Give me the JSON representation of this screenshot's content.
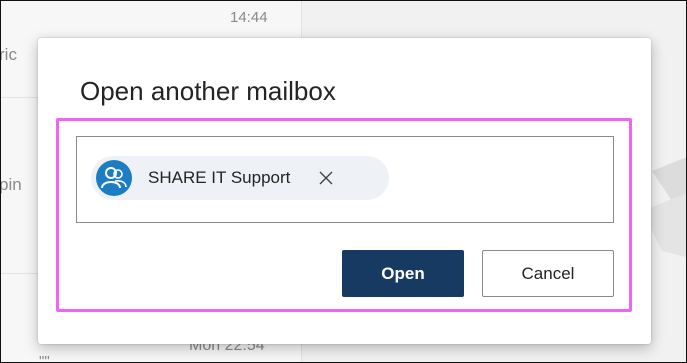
{
  "background": {
    "time_top": "14:44",
    "fragment_ric": "ric",
    "fragment_pin": "pin",
    "time_bottom": "Mon 22:54",
    "fragment_quote": "\"\""
  },
  "dialog": {
    "title": "Open another mailbox",
    "chip_label": "SHARE IT Support",
    "chip_remove_icon": "close-icon",
    "avatar_icon": "group-people-icon",
    "open_label": "Open",
    "cancel_label": "Cancel"
  },
  "colors": {
    "primary_button": "#163a62",
    "highlight": "#f064f0",
    "avatar": "#1d7dc4"
  }
}
